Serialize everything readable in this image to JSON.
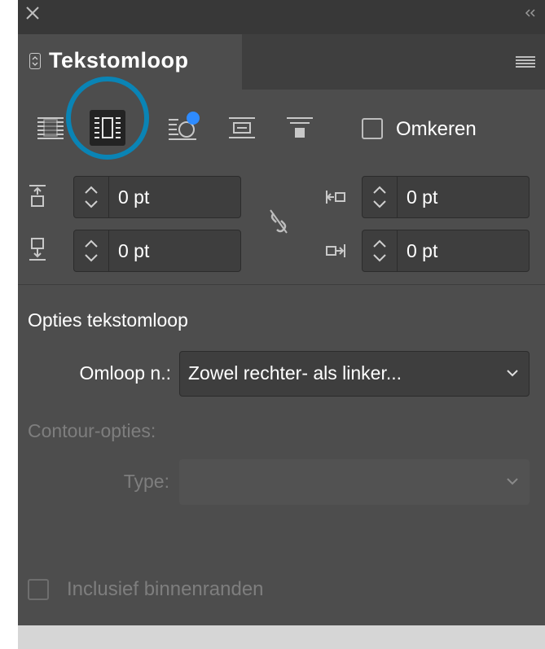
{
  "panel": {
    "title": "Tekstomloop",
    "close_icon": "close-icon",
    "collapse_icon": "double-chevron-left-icon",
    "menu_icon": "hamburger-menu-icon"
  },
  "wrap_modes": [
    {
      "name": "no-text-wrap",
      "icon": "no-wrap-icon",
      "selected": false
    },
    {
      "name": "wrap-around-bounding-box",
      "icon": "wrap-bounding-box-icon",
      "selected": true
    },
    {
      "name": "wrap-around-object-shape",
      "icon": "wrap-object-shape-icon",
      "selected": false
    },
    {
      "name": "jump-object",
      "icon": "jump-object-icon",
      "selected": false
    },
    {
      "name": "jump-to-next-column",
      "icon": "jump-to-next-column-icon",
      "selected": false
    }
  ],
  "invert": {
    "label": "Omkeren",
    "checked": false
  },
  "offsets": {
    "top": "0 pt",
    "bottom": "0 pt",
    "left": "0 pt",
    "right": "0 pt",
    "link_icon": "unlinked-chain-icon"
  },
  "wrap_options": {
    "section_title": "Opties tekstomloop",
    "wrap_to_label": "Omloop n.:",
    "wrap_to_value": "Zowel rechter- als linker..."
  },
  "contour_options": {
    "section_title": "Contour-opties:",
    "type_label": "Type:",
    "type_value": ""
  },
  "include_inside_edges": {
    "label": "Inclusief binnenranden",
    "checked": false
  },
  "colors": {
    "panel": "#4d4d4d",
    "accent_ring": "#0a84b5",
    "badge_blue": "#2e8bff"
  }
}
